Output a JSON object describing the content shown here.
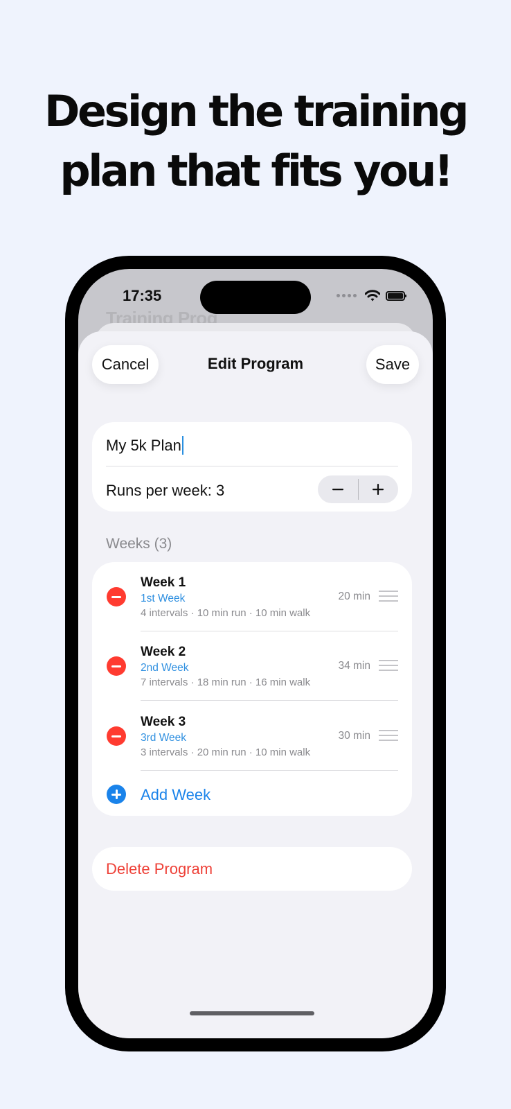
{
  "headline": {
    "line1": "Design the training",
    "line2": "plan that fits you!"
  },
  "status_bar": {
    "time": "17:35",
    "icons": [
      "signal-dots-icon",
      "wifi-icon",
      "battery-icon"
    ]
  },
  "background_screen": {
    "title": "Training Prog"
  },
  "nav": {
    "cancel": "Cancel",
    "title": "Edit Program",
    "save": "Save"
  },
  "program": {
    "name": "My 5k Plan",
    "runs_per_week_label": "Runs per week: 3",
    "stepper": {
      "decrement": "−",
      "increment": "+"
    }
  },
  "weeks": {
    "header": "Weeks (3)",
    "items": [
      {
        "title": "Week 1",
        "subtitle": "1st Week",
        "details": "4 intervals · 10 min run · 10 min walk",
        "duration": "20 min"
      },
      {
        "title": "Week 2",
        "subtitle": "2nd Week",
        "details": "7 intervals · 18 min run · 16 min walk",
        "duration": "34 min"
      },
      {
        "title": "Week 3",
        "subtitle": "3rd Week",
        "details": "3 intervals · 20 min run · 10 min walk",
        "duration": "30 min"
      }
    ],
    "add_label": "Add Week"
  },
  "delete_label": "Delete Program",
  "colors": {
    "page_background": "#eff3fd",
    "accent_blue": "#1a83ea",
    "destructive_red": "#ff3b30",
    "grouped_background": "#f2f2f7"
  }
}
